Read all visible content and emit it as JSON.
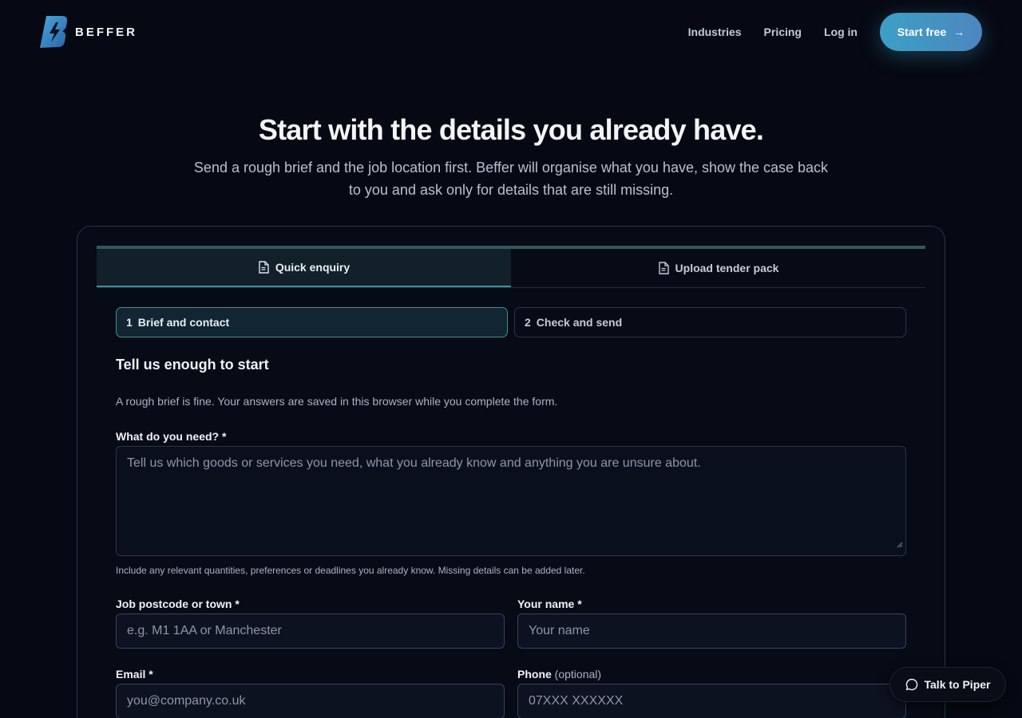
{
  "brand": {
    "name": "BEFFER",
    "logo_icon": "beffer-b-lightning-logo"
  },
  "nav": {
    "links": [
      "Industries",
      "Pricing",
      "Log in"
    ],
    "cta_label": "Start free",
    "cta_icon": "arrow-right-icon"
  },
  "hero": {
    "title": "Start with the details you already have.",
    "subtitle": "Send a rough brief and the job location first. Beffer will organise what you have, show the case back to you and ask only for details that are still missing."
  },
  "tabs": [
    {
      "label": "Quick enquiry",
      "icon": "document-icon",
      "active": true
    },
    {
      "label": "Upload tender pack",
      "icon": "document-icon",
      "active": false
    }
  ],
  "steps": [
    {
      "num": "1",
      "label": "Brief and contact",
      "active": true
    },
    {
      "num": "2",
      "label": "Check and send",
      "active": false
    }
  ],
  "form": {
    "title": "Tell us enough to start",
    "description": "A rough brief is fine. Your answers are saved in this browser while you complete the form.",
    "need": {
      "label": "What do you need? *",
      "placeholder": "Tell us which goods or services you need, what you already know and anything you are unsure about.",
      "hint": "Include any relevant quantities, preferences or deadlines you already know. Missing details can be added later."
    },
    "postcode": {
      "label": "Job postcode or town *",
      "placeholder": "e.g. M1 1AA or Manchester"
    },
    "name": {
      "label": "Your name *",
      "placeholder": "Your name"
    },
    "email": {
      "label": "Email *",
      "placeholder": "you@company.co.uk"
    },
    "phone": {
      "label": "Phone",
      "label_optional": "(optional)",
      "placeholder": "07XXX XXXXXX"
    }
  },
  "chat": {
    "label": "Talk to Piper",
    "icon": "chat-bubble-icon"
  },
  "colors": {
    "background": "#060913",
    "accent": "#3ba0c6",
    "teal_border": "#3f8f92"
  }
}
